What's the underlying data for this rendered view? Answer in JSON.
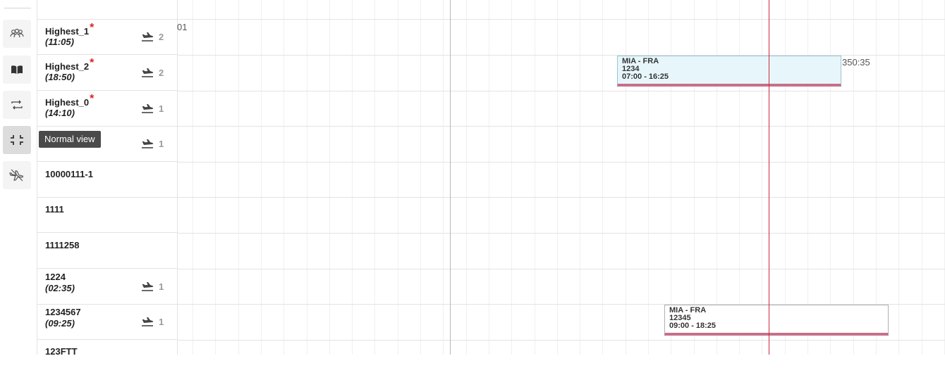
{
  "toolbar": {
    "tooltip": "Normal view",
    "tools": [
      {
        "icon": "users-icon"
      },
      {
        "icon": "book-icon"
      },
      {
        "icon": "rotation-icon"
      },
      {
        "icon": "compress-icon",
        "active": true
      },
      {
        "icon": "plane-off-icon"
      }
    ]
  },
  "resources": [
    {
      "name": "Highest_1",
      "required": "*",
      "duration": "(11:05)",
      "count": "2"
    },
    {
      "name": "Highest_2",
      "required": "*",
      "duration": "(18:50)",
      "count": "2"
    },
    {
      "name": "Highest_0",
      "required": "*",
      "duration": "(14:10)",
      "count": "1"
    },
    {
      "name": "",
      "required": "",
      "duration": "",
      "count": "1"
    },
    {
      "name": "10000111-1",
      "required": "",
      "duration": "",
      "count": ""
    },
    {
      "name": "1111",
      "required": "",
      "duration": "",
      "count": ""
    },
    {
      "name": "1111258",
      "required": "",
      "duration": "",
      "count": ""
    },
    {
      "name": "1224",
      "required": "",
      "duration": "(02:35)",
      "count": "1"
    },
    {
      "name": "1234567",
      "required": "",
      "duration": "(09:25)",
      "count": "1"
    },
    {
      "name": "123FTT",
      "required": "",
      "duration": "",
      "count": ""
    }
  ],
  "timeline": {
    "partial_label_row0": "01",
    "partial_label_row1": "350:35",
    "flights": [
      {
        "route": "MIA - FRA",
        "number": "1234",
        "time": "07:00 - 16:25",
        "selected": true
      },
      {
        "route": "MIA - FRA",
        "number": "12345",
        "time": "09:00 - 18:25",
        "selected": false
      }
    ]
  },
  "colors": {
    "now_line": "#c8283c",
    "flight_bar": "#c6708a",
    "selected_flight_bg": "#e7f6fb",
    "required_mark": "#e02020",
    "tooltip_bg": "#4a4a4a"
  }
}
